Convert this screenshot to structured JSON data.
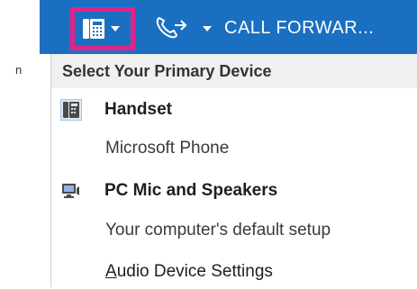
{
  "toolbar": {
    "device_button_icon": "handset-icon",
    "forward_icon": "call-forward-icon",
    "call_forward_label": "CALL FORWAR...",
    "accent_color": "#1b6fc1",
    "highlight_color": "#e0248a"
  },
  "left_fragment": {
    "text": "n"
  },
  "menu": {
    "header": "Select Your Primary Device",
    "items": [
      {
        "label": "Handset",
        "icon": "handset-icon",
        "bold": true,
        "selected": true
      },
      {
        "label": "Microsoft Phone",
        "sub": true
      },
      {
        "label": "PC Mic and Speakers",
        "icon": "pc-speakers-icon",
        "bold": true
      },
      {
        "label": "Your computer's default setup",
        "sub": true
      },
      {
        "label_accel": "A",
        "label_rest": "udio Device Settings"
      }
    ]
  }
}
